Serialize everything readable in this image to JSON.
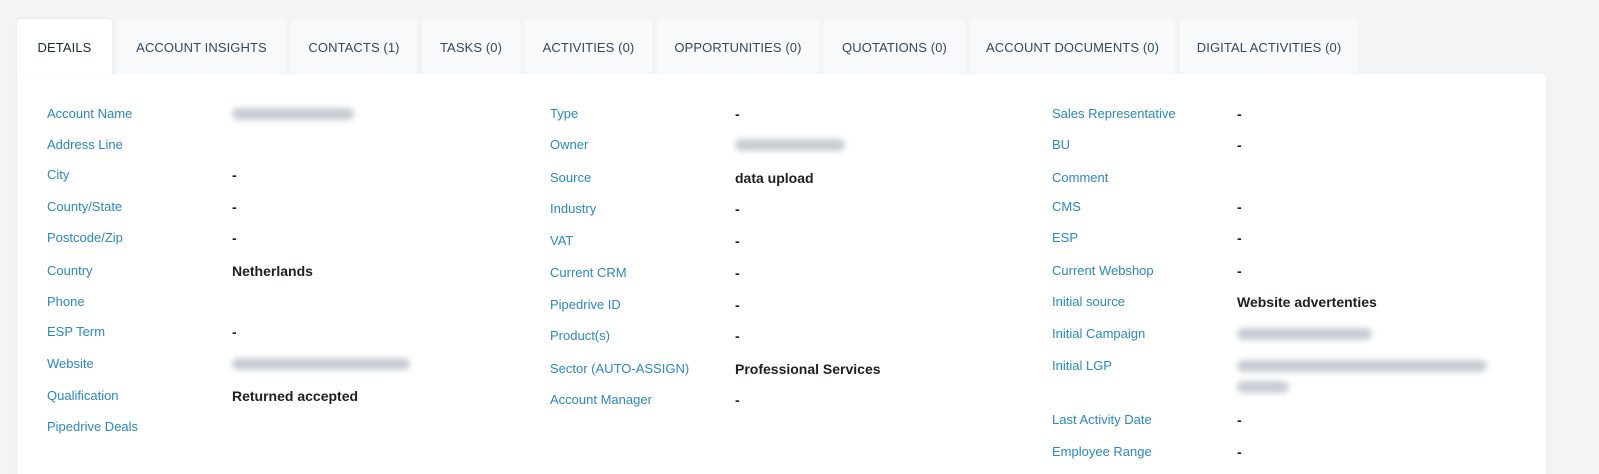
{
  "tabs": [
    {
      "label": "DETAILS",
      "active": true
    },
    {
      "label": "ACCOUNT INSIGHTS",
      "active": false
    },
    {
      "label": "CONTACTS (1)",
      "active": false
    },
    {
      "label": "TASKS (0)",
      "active": false
    },
    {
      "label": "ACTIVITIES (0)",
      "active": false
    },
    {
      "label": "OPPORTUNITIES (0)",
      "active": false
    },
    {
      "label": "QUOTATIONS (0)",
      "active": false
    },
    {
      "label": "ACCOUNT DOCUMENTS (0)",
      "active": false
    },
    {
      "label": "DIGITAL ACTIVITIES (0)",
      "active": false
    }
  ],
  "colors": {
    "label": "#2a87c4",
    "value": "#1b1f24",
    "tab_text": "#35485e",
    "background": "#f3f4f6"
  },
  "col1": {
    "account_name": {
      "label": "Account Name",
      "value": "[redacted]"
    },
    "address_line": {
      "label": "Address Line",
      "value": ""
    },
    "city": {
      "label": "City",
      "value": "-"
    },
    "county_state": {
      "label": "County/State",
      "value": "-"
    },
    "postcode_zip": {
      "label": "Postcode/Zip",
      "value": "-"
    },
    "country": {
      "label": "Country",
      "value": "Netherlands"
    },
    "phone": {
      "label": "Phone",
      "value": ""
    },
    "esp_term": {
      "label": "ESP Term",
      "value": "-"
    },
    "website": {
      "label": "Website",
      "value": "[redacted]"
    },
    "qualification": {
      "label": "Qualification",
      "value": "Returned accepted"
    },
    "pipedrive_deals": {
      "label": "Pipedrive Deals",
      "value": ""
    }
  },
  "col2": {
    "type": {
      "label": "Type",
      "value": "-"
    },
    "owner": {
      "label": "Owner",
      "value": "[redacted]"
    },
    "source": {
      "label": "Source",
      "value": "data upload"
    },
    "industry": {
      "label": "Industry",
      "value": "-"
    },
    "vat": {
      "label": "VAT",
      "value": "-"
    },
    "current_crm": {
      "label": "Current CRM",
      "value": "-"
    },
    "pipedrive_id": {
      "label": "Pipedrive ID",
      "value": "-"
    },
    "products": {
      "label": "Product(s)",
      "value": "-"
    },
    "sector": {
      "label": "Sector (AUTO-ASSIGN)",
      "value": "Professional Services"
    },
    "account_manager": {
      "label": "Account Manager",
      "value": "-"
    }
  },
  "col3": {
    "sales_rep": {
      "label": "Sales Representative",
      "value": "-"
    },
    "bu": {
      "label": "BU",
      "value": "-"
    },
    "comment": {
      "label": "Comment",
      "value": ""
    },
    "cms": {
      "label": "CMS",
      "value": "-"
    },
    "esp": {
      "label": "ESP",
      "value": "-"
    },
    "current_webshop": {
      "label": "Current Webshop",
      "value": "-"
    },
    "initial_source": {
      "label": "Initial source",
      "value": "Website advertenties"
    },
    "initial_campaign": {
      "label": "Initial Campaign",
      "value": "[redacted]"
    },
    "initial_lgp": {
      "label": "Initial LGP",
      "value": "[redacted]"
    },
    "last_activity_date": {
      "label": "Last Activity Date",
      "value": "-"
    },
    "employee_range": {
      "label": "Employee Range",
      "value": "-"
    }
  }
}
